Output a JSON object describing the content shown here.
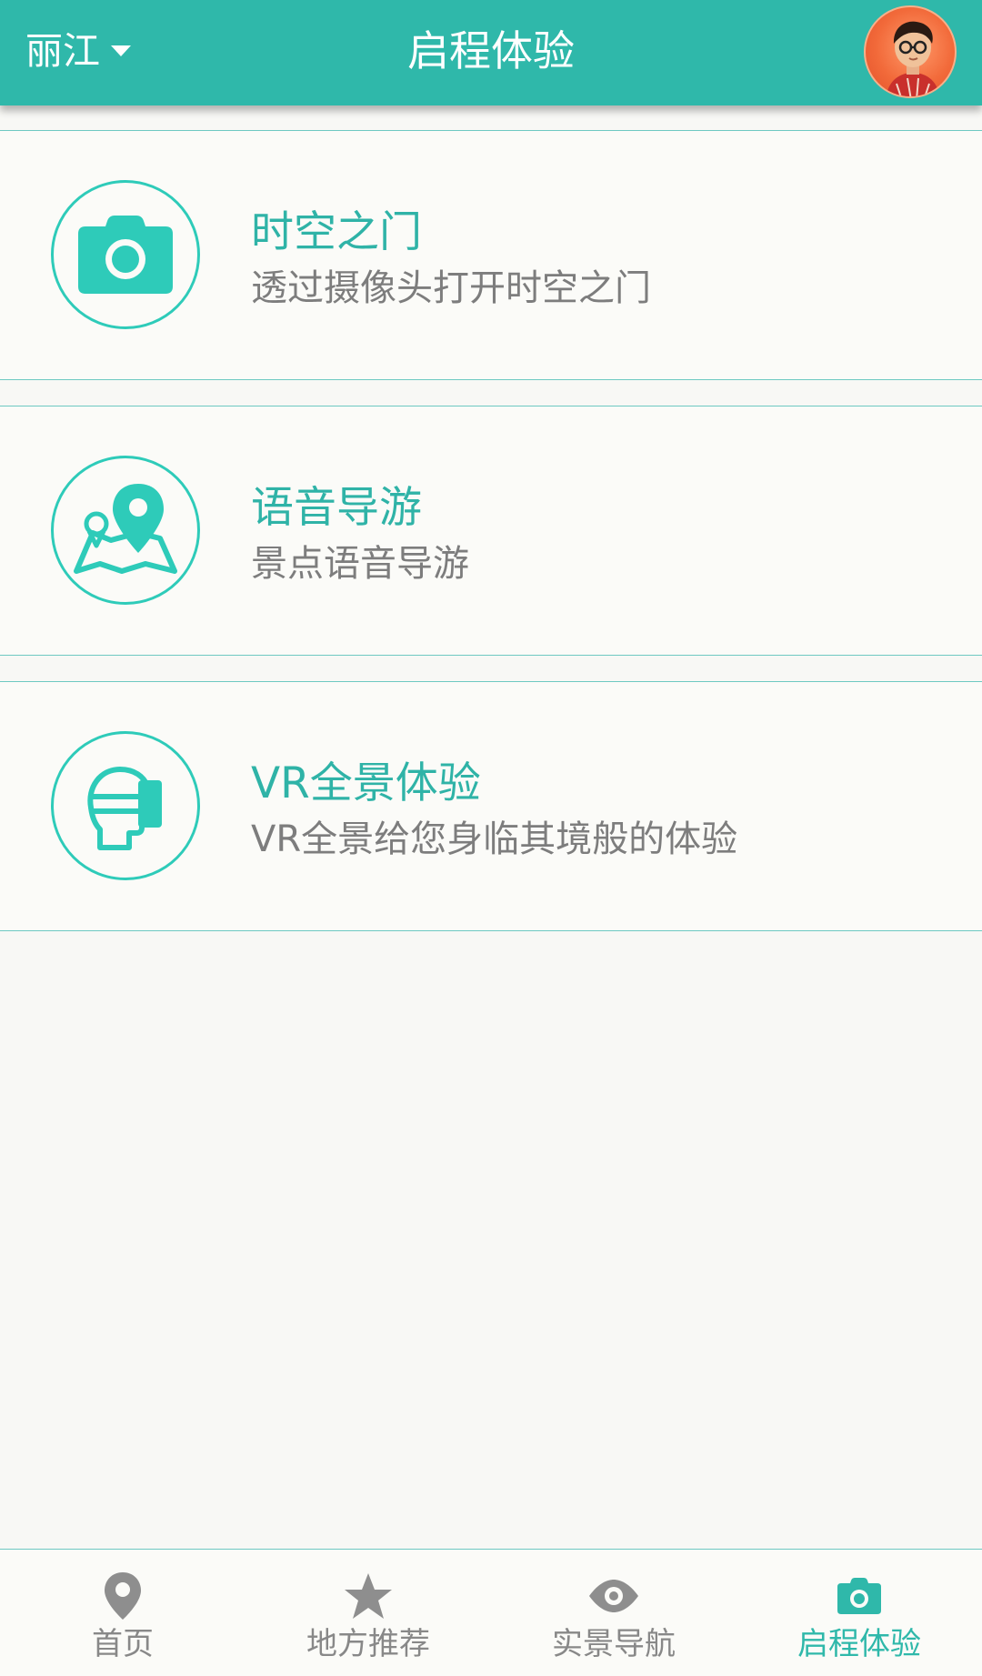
{
  "header": {
    "city": "丽江",
    "title": "启程体验"
  },
  "cards": [
    {
      "title": "时空之门",
      "description": "透过摄像头打开时空之门",
      "icon": "camera-icon"
    },
    {
      "title": "语音导游",
      "description": "景点语音导游",
      "icon": "map-pin-icon"
    },
    {
      "title": "VR全景体验",
      "description": "VR全景给您身临其境般的体验",
      "icon": "vr-headset-icon"
    }
  ],
  "bottom_nav": [
    {
      "label": "首页",
      "icon": "location-pin-icon",
      "active": false
    },
    {
      "label": "地方推荐",
      "icon": "star-icon",
      "active": false
    },
    {
      "label": "实景导航",
      "icon": "eye-icon",
      "active": false
    },
    {
      "label": "启程体验",
      "icon": "camera-icon",
      "active": true
    }
  ],
  "colors": {
    "accent": "#2fb8aa",
    "icon": "#2ecbb9",
    "inactive": "#888888",
    "background": "#f8f8f5"
  }
}
